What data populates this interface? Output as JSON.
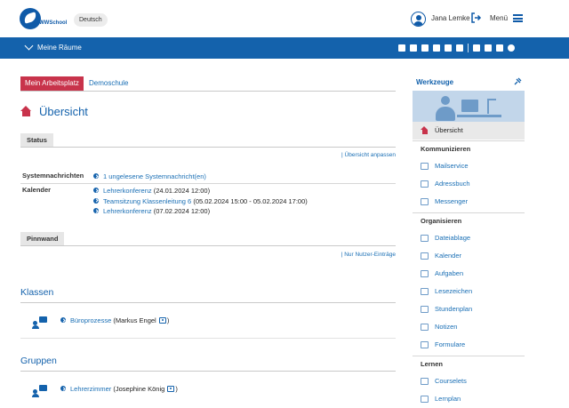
{
  "header": {
    "logo_text": "WWSchool",
    "language": "Deutsch",
    "user_name": "Jana Lemke",
    "menu_label": "Menü"
  },
  "rooms_bar": {
    "label": "Meine Räume",
    "icons": [
      "pin-icon",
      "people-icon",
      "mail-icon",
      "pencil-icon",
      "note-icon",
      "bookmark-icon",
      "enter-icon",
      "sitemap-icon",
      "print-icon",
      "help-icon"
    ]
  },
  "tabs": [
    {
      "label": "Mein Arbeitsplatz",
      "active": true
    },
    {
      "label": "Demoschule",
      "active": false
    }
  ],
  "page_title": "Übersicht",
  "status": {
    "heading": "Status",
    "action_link": "Übersicht anpassen",
    "rows": [
      {
        "key": "Systemnachrichten",
        "items": [
          {
            "link": "1 ungelesene Systemnachricht(en)",
            "suffix": ""
          }
        ]
      },
      {
        "key": "Kalender",
        "items": [
          {
            "link": "Lehrerkonferenz",
            "suffix": " (24.01.2024 12:00)"
          },
          {
            "link": "Teamsitzung Klassenleitung 6",
            "suffix": " (05.02.2024 15:00 - 05.02.2024 17:00)"
          },
          {
            "link": "Lehrerkonferenz",
            "suffix": " (07.02.2024 12:00)"
          }
        ]
      }
    ]
  },
  "pinnwand": {
    "heading": "Pinnwand",
    "action_link": "Nur Nutzer-Einträge"
  },
  "klassen": {
    "title": "Klassen",
    "items": [
      {
        "link": "Büroprozesse",
        "owner": "(Markus Engel"
      }
    ]
  },
  "gruppen": {
    "title": "Gruppen",
    "items": [
      {
        "link": "Lehrerzimmer",
        "owner": "(Josephine König"
      }
    ]
  },
  "closing_paren": ")",
  "sidebar": {
    "title": "Werkzeuge",
    "overview": "Übersicht",
    "categories": [
      {
        "name": "Kommunizieren",
        "items": [
          "Mailservice",
          "Adressbuch",
          "Messenger"
        ]
      },
      {
        "name": "Organisieren",
        "items": [
          "Dateiablage",
          "Kalender",
          "Aufgaben",
          "Lesezeichen",
          "Stundenplan",
          "Notizen",
          "Formulare"
        ]
      },
      {
        "name": "Lernen",
        "items": [
          "Courselets",
          "Lernplan"
        ]
      }
    ]
  },
  "colors": {
    "brand_blue": "#1462ac",
    "accent_red": "#c8334b",
    "link_blue": "#1a6fb5"
  }
}
